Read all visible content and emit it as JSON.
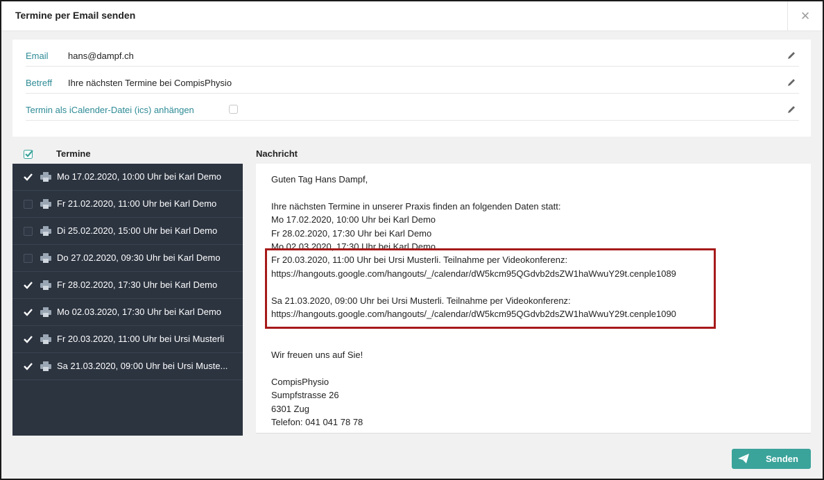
{
  "dialog": {
    "title": "Termine per Email senden",
    "close_symbol": "×"
  },
  "form": {
    "email_label": "Email",
    "email_value": "hans@dampf.ch",
    "subject_label": "Betreff",
    "subject_value": "Ihre nächsten Termine bei CompisPhysio",
    "ics_label": "Termin als iCalender-Datei (ics) anhängen",
    "ics_checked": false
  },
  "appointments": {
    "header": "Termine",
    "all_checked": true,
    "items": [
      {
        "label": "Mo 17.02.2020, 10:00 Uhr bei Karl Demo",
        "checked": true
      },
      {
        "label": "Fr 21.02.2020, 11:00 Uhr bei Karl Demo",
        "checked": false
      },
      {
        "label": "Di 25.02.2020, 15:00 Uhr bei Karl Demo",
        "checked": false
      },
      {
        "label": "Do 27.02.2020, 09:30 Uhr bei Karl Demo",
        "checked": false
      },
      {
        "label": "Fr 28.02.2020, 17:30 Uhr bei Karl Demo",
        "checked": true
      },
      {
        "label": "Mo 02.03.2020, 17:30 Uhr bei Karl Demo",
        "checked": true
      },
      {
        "label": "Fr 20.03.2020, 11:00 Uhr bei Ursi Musterli",
        "checked": true
      },
      {
        "label": "Sa 21.03.2020, 09:00 Uhr bei Ursi Muste...",
        "checked": true
      }
    ]
  },
  "message": {
    "header": "Nachricht",
    "lines": [
      "Guten Tag Hans Dampf,",
      "",
      "Ihre nächsten Termine in unserer Praxis finden an folgenden Daten statt:",
      "Mo 17.02.2020, 10:00 Uhr bei Karl Demo",
      "Fr 28.02.2020, 17:30 Uhr bei Karl Demo",
      "Mo 02.03.2020, 17:30 Uhr bei Karl Demo",
      "Fr 20.03.2020, 11:00 Uhr bei Ursi Musterli. Teilnahme per Videokonferenz:",
      "https://hangouts.google.com/hangouts/_/calendar/dW5kcm95QGdvb2dsZW1haWwuY29t.cenple1089",
      "",
      "Sa 21.03.2020, 09:00 Uhr bei Ursi Musterli. Teilnahme per Videokonferenz:",
      "https://hangouts.google.com/hangouts/_/calendar/dW5kcm95QGdvb2dsZW1haWwuY29t.cenple1090",
      "",
      "",
      "Wir freuen uns auf Sie!",
      "",
      "CompisPhysio",
      "Sumpfstrasse 26",
      "6301 Zug",
      "Telefon: 041 041 78 78"
    ]
  },
  "actions": {
    "send_label": "Senden"
  },
  "colors": {
    "accent": "#3aa39a",
    "list_bg": "#2c3440",
    "highlight": "#a61a1a"
  }
}
